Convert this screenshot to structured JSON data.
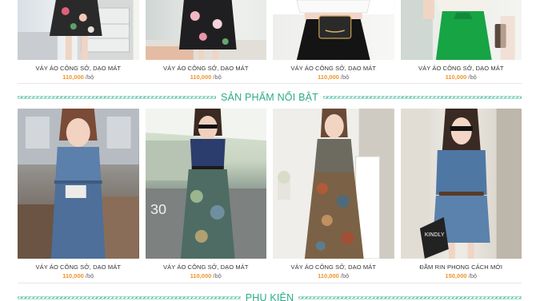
{
  "top_products": [
    {
      "name": "VÁY ÁO CÔNG SỞ, DẠO MÁT",
      "price": "110,000",
      "unit": "/bộ"
    },
    {
      "name": "VÁY ÁO CÔNG SỞ, DẠO MÁT",
      "price": "110,000",
      "unit": "/bộ"
    },
    {
      "name": "VÁY ÁO CÔNG SỞ, DẠO MÁT",
      "price": "110,000",
      "unit": "/bộ"
    },
    {
      "name": "VÁY ÁO CÔNG SỞ, DẠO MÁT",
      "price": "110,000",
      "unit": "/bộ"
    }
  ],
  "featured": {
    "title": "SẢN PHẨM NỔI BẬT",
    "products": [
      {
        "name": "VÁY ÁO CÔNG SỞ, DẠO MÁT",
        "price": "110,000",
        "unit": "/bộ"
      },
      {
        "name": "VÁY ÁO CÔNG SỞ, DẠO MÁT",
        "price": "110,000",
        "unit": "/bộ"
      },
      {
        "name": "VÁY ÁO CÔNG SỞ, DẠO MÁT",
        "price": "110,000",
        "unit": "/bộ"
      },
      {
        "name": "ĐẦM RIN PHONG CÁCH MỚI",
        "price": "150,000",
        "unit": "/bộ"
      }
    ]
  },
  "accessories": {
    "title": "PHỤ KIỆN"
  },
  "colors": {
    "accent": "#2daa86",
    "price": "#f2932a",
    "stripe": "#67c4ad"
  }
}
